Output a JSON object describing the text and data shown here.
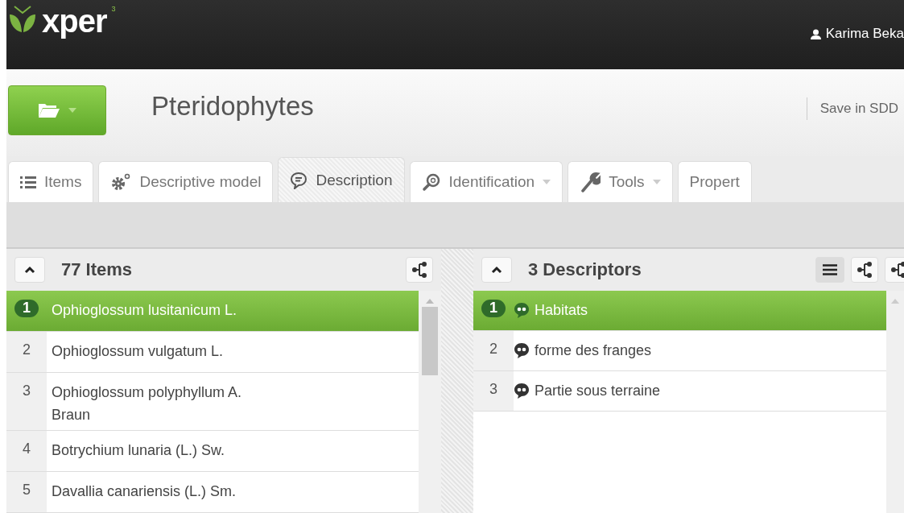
{
  "app": {
    "logo": "xper",
    "logo_sup": "3",
    "user": "Karima Beka"
  },
  "project": {
    "title": "Pteridophytes",
    "actions": [
      "Save in SDD"
    ]
  },
  "tabs": [
    {
      "label": "Items",
      "kind": "list",
      "selected": false,
      "dropdown": false
    },
    {
      "label": "Descriptive model",
      "kind": "gears",
      "selected": false,
      "dropdown": false
    },
    {
      "label": "Description",
      "kind": "speech",
      "selected": true,
      "dropdown": false
    },
    {
      "label": "Identification",
      "kind": "magnifier",
      "selected": false,
      "dropdown": true
    },
    {
      "label": "Tools",
      "kind": "wrench",
      "selected": false,
      "dropdown": true
    },
    {
      "label": "Propert",
      "kind": "none",
      "selected": false,
      "dropdown": false
    }
  ],
  "items_panel": {
    "title": "77 Items",
    "rows": [
      {
        "number": "1",
        "name": "Ophioglossum lusitanicum L.",
        "selected": true
      },
      {
        "number": "2",
        "name": "Ophioglossum vulgatum L.",
        "selected": false
      },
      {
        "number": "3",
        "name": "Ophioglossum polyphyllum A. Braun",
        "selected": false
      },
      {
        "number": "4",
        "name": "Botrychium lunaria (L.) Sw.",
        "selected": false
      },
      {
        "number": "5",
        "name": "Davallia canariensis (L.) Sm.",
        "selected": false
      }
    ]
  },
  "descriptors_panel": {
    "title": "3 Descriptors",
    "rows": [
      {
        "number": "1",
        "name": "Habitats",
        "selected": true
      },
      {
        "number": "2",
        "name": "forme des franges",
        "selected": false
      },
      {
        "number": "3",
        "name": "Partie sous terraine",
        "selected": false
      }
    ]
  }
}
